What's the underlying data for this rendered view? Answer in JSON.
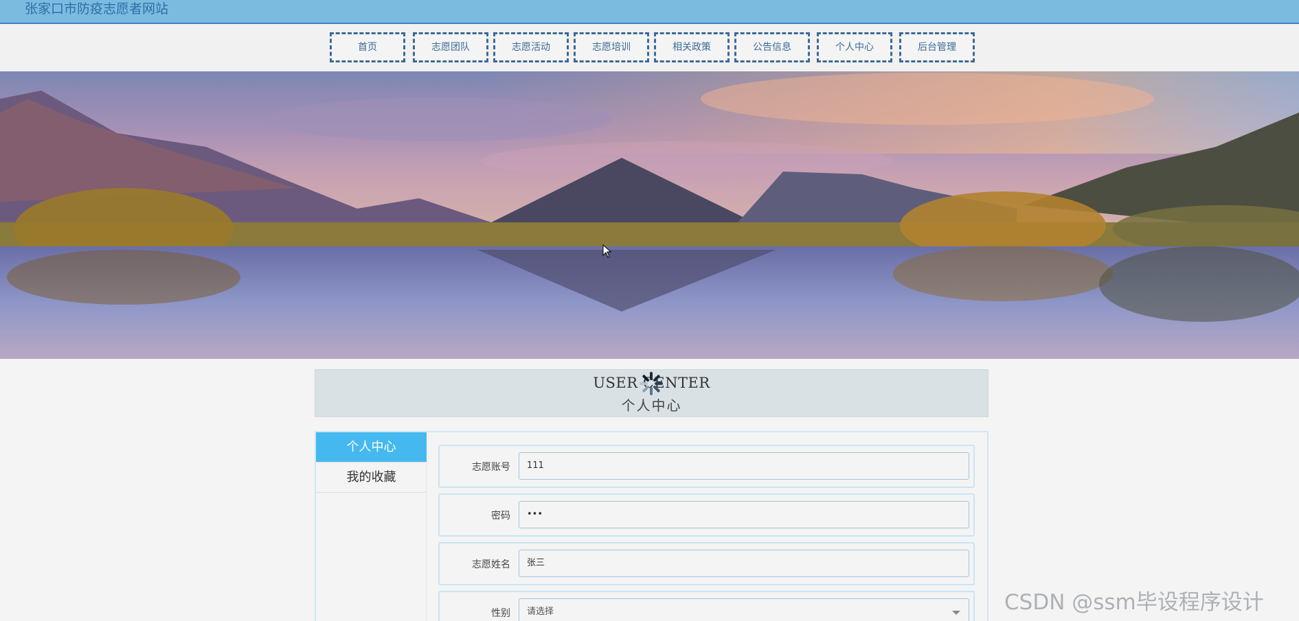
{
  "site": {
    "title": "张家口市防疫志愿者网站"
  },
  "nav": {
    "items": [
      "首页",
      "志愿团队",
      "志愿活动",
      "志愿培训",
      "相关政策",
      "公告信息",
      "个人中心",
      "后台管理"
    ]
  },
  "banner": {
    "slides": 3,
    "active_slide": 1
  },
  "user_center": {
    "title_en": "USER CENTER",
    "title_cn": "个人中心"
  },
  "sidebar": {
    "items": [
      {
        "label": "个人中心",
        "active": true
      },
      {
        "label": "我的收藏",
        "active": false
      }
    ]
  },
  "form": {
    "account_label": "志愿账号",
    "account_value": "111",
    "password_label": "密码",
    "password_value": "•••",
    "name_label": "志愿姓名",
    "name_value": "张三",
    "gender_label": "性别",
    "gender_placeholder": "请选择"
  },
  "colors": {
    "topbar": "#7cbbe0",
    "accent": "#45b9ef",
    "nav_border": "#3b6a98"
  },
  "watermark": "CSDN @ssm毕设程序设计"
}
